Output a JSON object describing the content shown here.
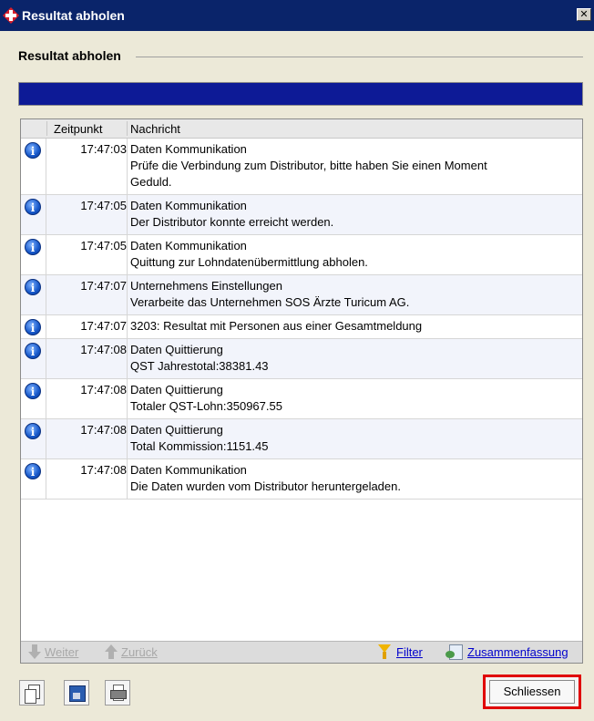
{
  "window": {
    "title": "Resultat abholen",
    "close_glyph": "✕"
  },
  "group": {
    "label": "Resultat abholen"
  },
  "progress": {
    "value": 1.0,
    "color": "#0d1a96"
  },
  "table": {
    "headers": {
      "time": "Zeitpunkt",
      "message": "Nachricht"
    },
    "rows": [
      {
        "icon": "info-icon",
        "time": "17:47:03",
        "lines": [
          "Daten Kommunikation",
          "Prüfe die Verbindung zum Distributor, bitte haben Sie einen Moment",
          "Geduld."
        ]
      },
      {
        "icon": "info-icon",
        "time": "17:47:05",
        "lines": [
          "Daten Kommunikation",
          "Der Distributor konnte erreicht werden."
        ]
      },
      {
        "icon": "info-icon",
        "time": "17:47:05",
        "lines": [
          "Daten Kommunikation",
          "Quittung zur Lohndatenübermittlung abholen."
        ]
      },
      {
        "icon": "info-icon",
        "time": "17:47:07",
        "lines": [
          "Unternehmens Einstellungen",
          "Verarbeite das Unternehmen  SOS Ärzte Turicum AG."
        ]
      },
      {
        "icon": "info-icon",
        "time": "17:47:07",
        "lines": [
          "3203: Resultat mit Personen aus einer Gesamtmeldung"
        ]
      },
      {
        "icon": "info-icon",
        "time": "17:47:08",
        "lines": [
          "Daten Quittierung",
          "QST Jahrestotal:38381.43"
        ]
      },
      {
        "icon": "info-icon",
        "time": "17:47:08",
        "lines": [
          "Daten Quittierung",
          "Totaler QST-Lohn:350967.55"
        ]
      },
      {
        "icon": "info-icon",
        "time": "17:47:08",
        "lines": [
          "Daten Quittierung",
          "Total Kommission:1151.45"
        ]
      },
      {
        "icon": "info-icon",
        "time": "17:47:08",
        "lines": [
          "Daten Kommunikation",
          "Die Daten wurden vom Distributor heruntergeladen."
        ]
      }
    ]
  },
  "nav": {
    "next": "Weiter",
    "back": "Zurück",
    "filter": "Filter",
    "summary": "Zusammenfassung"
  },
  "toolbar": {
    "copy_icon": "copy-icon",
    "save_icon": "save-icon",
    "print_icon": "print-icon"
  },
  "buttons": {
    "close": "Schliessen"
  },
  "colors": {
    "titlebar": "#0a246a",
    "highlight": "#e00000",
    "link": "#0000cc"
  }
}
